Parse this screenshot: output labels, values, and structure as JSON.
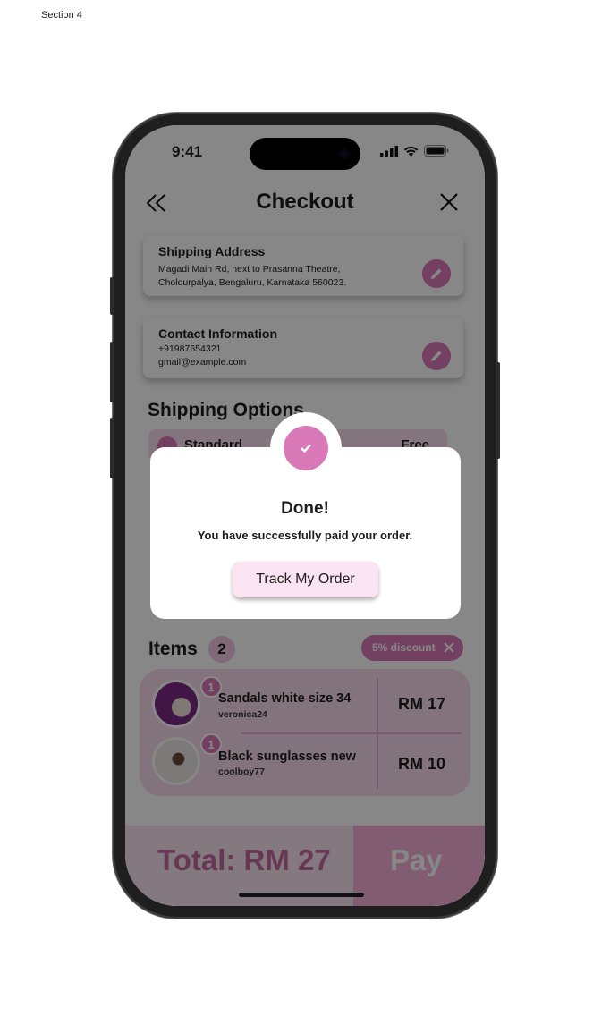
{
  "canvas": {
    "section_label": "Section 4"
  },
  "status_bar": {
    "time": "9:41"
  },
  "header": {
    "title": "Checkout"
  },
  "shipping_address": {
    "title": "Shipping Address",
    "line1": "Magadi Main Rd, next to Prasanna Theatre,",
    "line2": "Cholourpalya, Bengaluru, Karnataka 560023."
  },
  "contact": {
    "title": "Contact Information",
    "phone": "+91987654321",
    "email": "gmail@example.com"
  },
  "shipping_options": {
    "title": "Shipping Options",
    "selected_label": "Standard",
    "selected_price": "Free"
  },
  "items": {
    "title": "Items",
    "count": "2",
    "discount_label": "5% discount",
    "list": [
      {
        "name": "Sandals white size 34",
        "user": "veronica24",
        "qty": "1",
        "price": "RM 17"
      },
      {
        "name": "Black sunglasses new",
        "user": "coolboy77",
        "qty": "1",
        "price": "RM 10"
      }
    ]
  },
  "footer": {
    "total": "Total: RM 27",
    "pay_label": "Pay"
  },
  "modal": {
    "title": "Done!",
    "message": "You have successfully paid your order.",
    "button_label": "Track My Order"
  },
  "colors": {
    "accent": "#d979b8",
    "accent_light": "#fbe4f1",
    "overlay": "rgba(0,0,0,0.47)"
  }
}
